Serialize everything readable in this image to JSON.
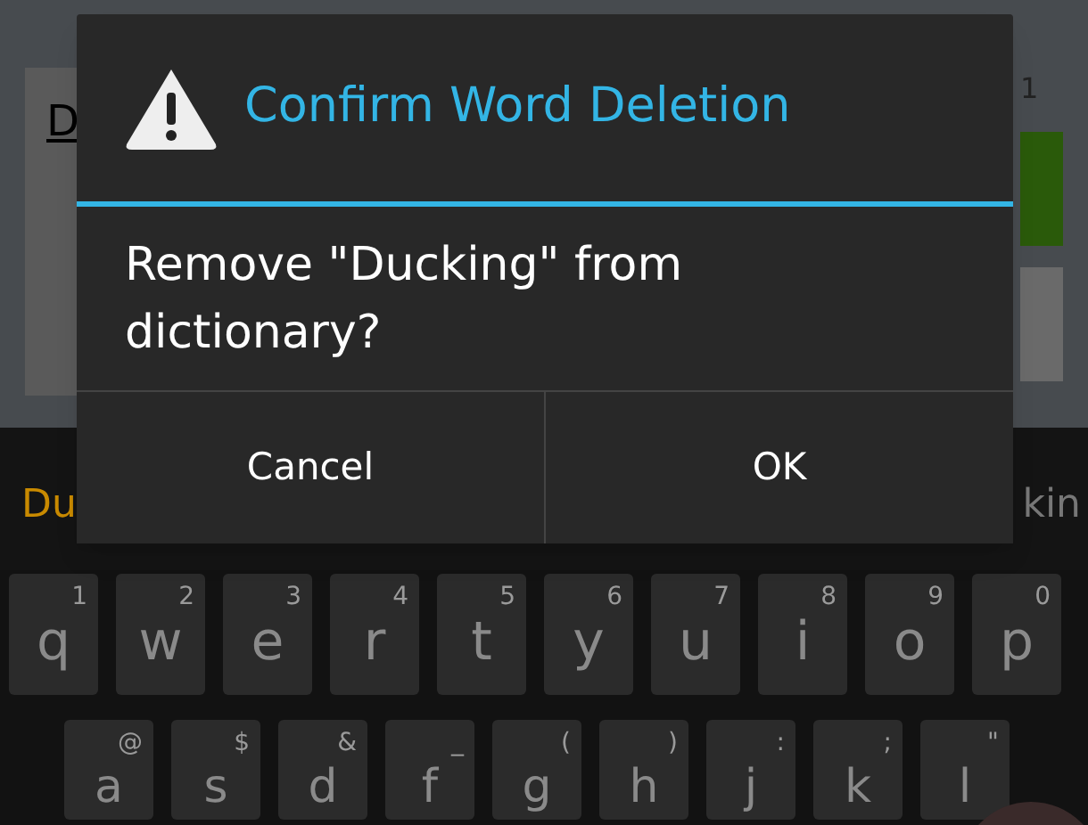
{
  "editor": {
    "word": "D",
    "count": "1"
  },
  "suggestions": [
    {
      "text": "Du",
      "selected": true
    },
    {
      "text": "kin",
      "selected": false
    }
  ],
  "dialog": {
    "title": "Confirm Word Deletion",
    "message": "Remove \"Ducking\" from dictionary?",
    "buttons": [
      "Cancel",
      "OK"
    ]
  },
  "keyboard": {
    "rows": [
      [
        {
          "key": "q",
          "hint": "1"
        },
        {
          "key": "w",
          "hint": "2"
        },
        {
          "key": "e",
          "hint": "3"
        },
        {
          "key": "r",
          "hint": "4"
        },
        {
          "key": "t",
          "hint": "5"
        },
        {
          "key": "y",
          "hint": "6"
        },
        {
          "key": "u",
          "hint": "7"
        },
        {
          "key": "i",
          "hint": "8"
        },
        {
          "key": "o",
          "hint": "9"
        },
        {
          "key": "p",
          "hint": "0"
        }
      ],
      [
        {
          "key": "a",
          "hint": "@"
        },
        {
          "key": "s",
          "hint": "$"
        },
        {
          "key": "d",
          "hint": "&"
        },
        {
          "key": "f",
          "hint": "_"
        },
        {
          "key": "g",
          "hint": "("
        },
        {
          "key": "h",
          "hint": ")"
        },
        {
          "key": "j",
          "hint": ":"
        },
        {
          "key": "k",
          "hint": ";"
        },
        {
          "key": "l",
          "hint": "\""
        }
      ]
    ]
  }
}
